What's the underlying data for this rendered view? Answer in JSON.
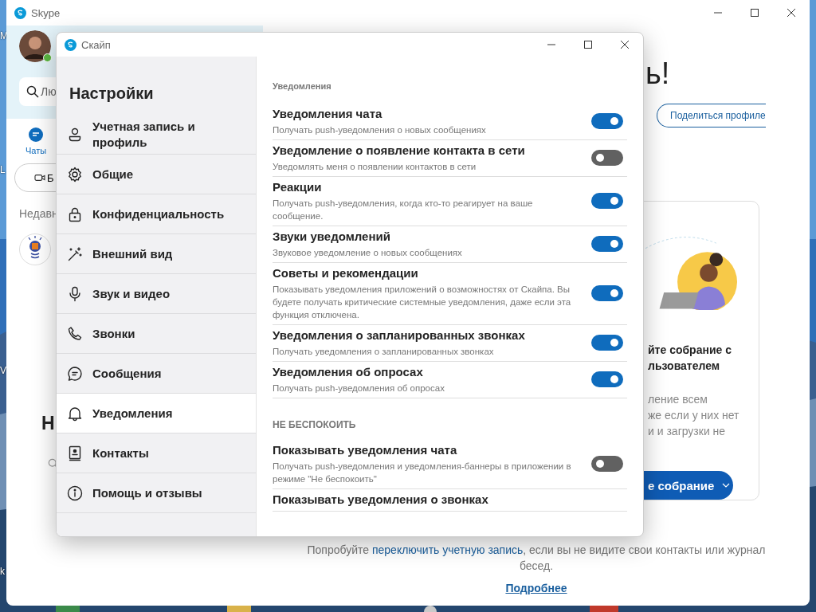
{
  "desktop": {
    "labels": [
      "M",
      "L",
      "V",
      "k"
    ]
  },
  "main_window": {
    "title": "Skype",
    "sidebar": {
      "online": true,
      "search": {
        "placeholder": "Лю"
      },
      "tabs": [
        {
          "label": "Чаты",
          "selected": true
        }
      ],
      "button": "Б",
      "recent_heading": "Недавн",
      "heading": "Н"
    },
    "content": {
      "greeting": "ь!",
      "share_button": "Поделиться профиле",
      "card": {
        "title_lines": [
          "йте собрание с",
          "льзователем"
        ],
        "text_lines": [
          "ление всем",
          "же если у них нет",
          "и и загрузки не"
        ],
        "button": "е собрание"
      },
      "footer": {
        "before": "Попробуйте ",
        "link": "переключить учетную запись",
        "after": ", если вы не видите свои контакты или журнал бесед.",
        "more_link": "Подробнее"
      }
    }
  },
  "settings": {
    "title": "Скайп",
    "heading": "Настройки",
    "nav": [
      {
        "label": "Учетная запись и профиль",
        "kind": "person",
        "selected": false
      },
      {
        "label": "Общие",
        "kind": "gear",
        "selected": false
      },
      {
        "label": "Конфиденциальность",
        "kind": "lock",
        "selected": false
      },
      {
        "label": "Внешний вид",
        "kind": "wand",
        "selected": false
      },
      {
        "label": "Звук и видео",
        "kind": "mic",
        "selected": false
      },
      {
        "label": "Звонки",
        "kind": "phone",
        "selected": false
      },
      {
        "label": "Сообщения",
        "kind": "chat",
        "selected": false
      },
      {
        "label": "Уведомления",
        "kind": "bell",
        "selected": true
      },
      {
        "label": "Контакты",
        "kind": "contact",
        "selected": false
      },
      {
        "label": "Помощь и отзывы",
        "kind": "info",
        "selected": false
      }
    ],
    "sections": [
      {
        "title": "Уведомления",
        "items": [
          {
            "title": "Уведомления чата",
            "description": "Получать push-уведомления о новых сообщениях",
            "on": true
          },
          {
            "title": "Уведомление о появление контакта в сети",
            "description": "Уведомлять меня о появлении контактов в сети",
            "on": false
          },
          {
            "title": "Реакции",
            "description": "Получать push-уведомления, когда кто-то реагирует на ваше сообщение.",
            "on": true
          },
          {
            "title": "Звуки уведомлений",
            "description": "Звуковое уведомление о новых сообщениях",
            "on": true
          },
          {
            "title": "Советы и рекомендации",
            "description": "Показывать уведомления приложений о возможностях от Скайпа. Вы будете получать критические системные уведомления, даже если эта функция отключена.",
            "on": true
          },
          {
            "title": "Уведомления о запланированных звонках",
            "description": "Получать уведомления о запланированных звонках",
            "on": true
          },
          {
            "title": "Уведомления об опросах",
            "description": "Получать push-уведомления об опросах",
            "on": true
          }
        ]
      },
      {
        "title": "НЕ БЕСПОКОИТЬ",
        "items": [
          {
            "title": "Показывать уведомления чата",
            "description": "Получать push-уведомления и уведомления-баннеры в приложении в режиме \"Не беспокоить\"",
            "on": false
          },
          {
            "title": "Показывать уведомления о звонках"
          }
        ]
      }
    ]
  }
}
